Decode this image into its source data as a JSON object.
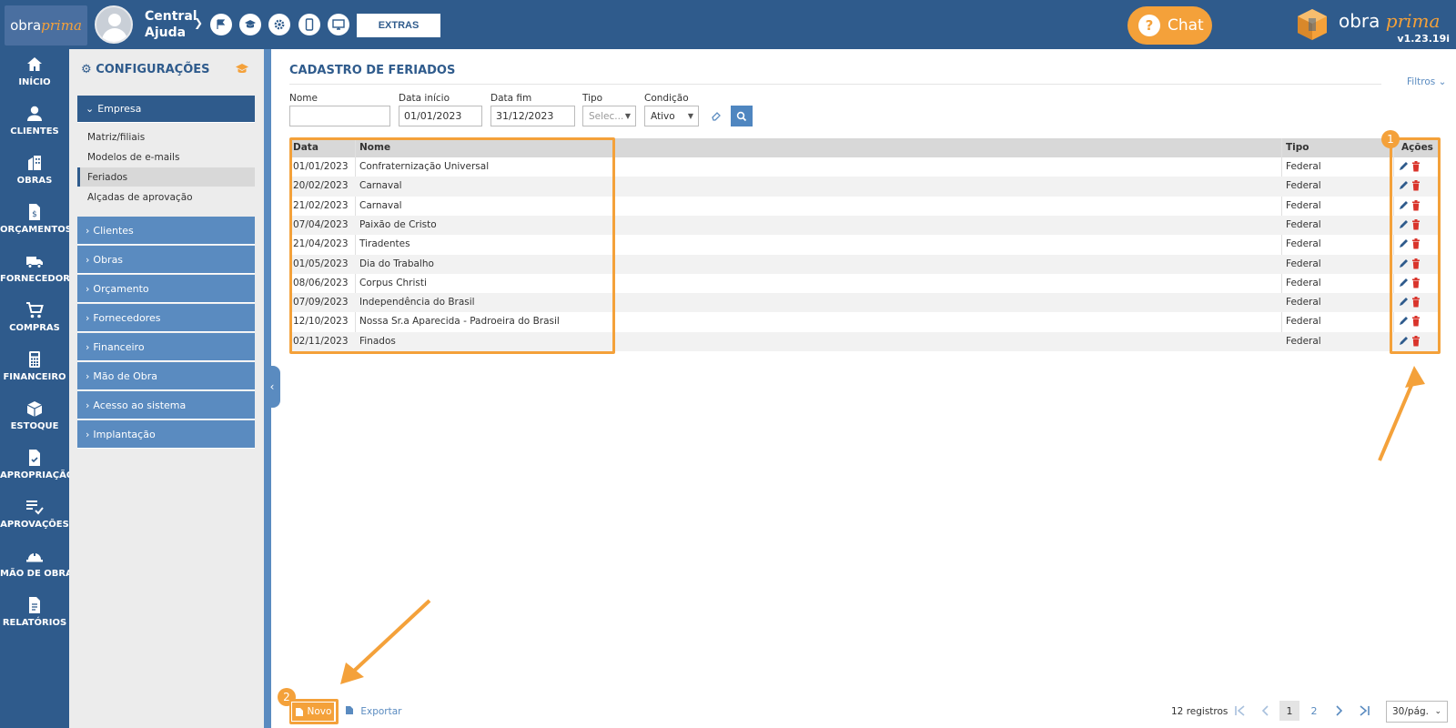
{
  "topbar": {
    "logo_left_a": "obra",
    "logo_left_b": "prima",
    "central_line1": "Central",
    "central_line2": "Ajuda",
    "extras_label": "EXTRAS",
    "chat_label": "Chat",
    "brand_a": "obra",
    "brand_b": "prima",
    "version": "v1.23.19i",
    "icons": [
      "flag-icon",
      "graduation-cap-icon",
      "gear-icon",
      "mobile-icon",
      "monitor-icon"
    ]
  },
  "nav": [
    {
      "label": "INÍCIO",
      "icon": "home-icon"
    },
    {
      "label": "CLIENTES",
      "icon": "person-icon"
    },
    {
      "label": "OBRAS",
      "icon": "building-icon"
    },
    {
      "label": "ORÇAMENTOS",
      "icon": "document-dollar-icon"
    },
    {
      "label": "FORNECEDORES",
      "icon": "truck-icon"
    },
    {
      "label": "COMPRAS",
      "icon": "cart-icon"
    },
    {
      "label": "FINANCEIRO",
      "icon": "calculator-icon"
    },
    {
      "label": "ESTOQUE",
      "icon": "box-icon"
    },
    {
      "label": "APROPRIAÇÃO",
      "icon": "document-check-icon"
    },
    {
      "label": "APROVAÇÕES",
      "icon": "list-check-icon"
    },
    {
      "label": "MÃO DE OBRA",
      "icon": "helmet-icon"
    },
    {
      "label": "RELATÓRIOS",
      "icon": "report-icon"
    }
  ],
  "config": {
    "title": "CONFIGURAÇÕES",
    "empresa": "Empresa",
    "empresa_items": [
      "Matriz/filiais",
      "Modelos de e-mails",
      "Feriados",
      "Alçadas de aprovação"
    ],
    "sections": [
      "Clientes",
      "Obras",
      "Orçamento",
      "Fornecedores",
      "Financeiro",
      "Mão de Obra",
      "Acesso ao sistema",
      "Implantação"
    ]
  },
  "page": {
    "title": "CADASTRO DE FERIADOS",
    "filtros": "Filtros"
  },
  "filters": {
    "nome_label": "Nome",
    "nome_value": "",
    "data_inicio_label": "Data início",
    "data_inicio_value": "01/01/2023",
    "data_fim_label": "Data fim",
    "data_fim_value": "31/12/2023",
    "tipo_label": "Tipo",
    "tipo_placeholder": "Selec...",
    "condicao_label": "Condição",
    "condicao_value": "Ativo"
  },
  "table": {
    "headers": {
      "data": "Data",
      "nome": "Nome",
      "tipo": "Tipo",
      "acoes": "Ações"
    },
    "rows": [
      {
        "data": "01/01/2023",
        "nome": "Confraternização Universal",
        "tipo": "Federal"
      },
      {
        "data": "20/02/2023",
        "nome": "Carnaval",
        "tipo": "Federal"
      },
      {
        "data": "21/02/2023",
        "nome": "Carnaval",
        "tipo": "Federal"
      },
      {
        "data": "07/04/2023",
        "nome": "Paixão de Cristo",
        "tipo": "Federal"
      },
      {
        "data": "21/04/2023",
        "nome": "Tiradentes",
        "tipo": "Federal"
      },
      {
        "data": "01/05/2023",
        "nome": "Dia do Trabalho",
        "tipo": "Federal"
      },
      {
        "data": "08/06/2023",
        "nome": "Corpus Christi",
        "tipo": "Federal"
      },
      {
        "data": "07/09/2023",
        "nome": "Independência do Brasil",
        "tipo": "Federal"
      },
      {
        "data": "12/10/2023",
        "nome": "Nossa Sr.a Aparecida - Padroeira do Brasil",
        "tipo": "Federal"
      },
      {
        "data": "02/11/2023",
        "nome": "Finados",
        "tipo": "Federal"
      }
    ]
  },
  "annotations": {
    "badge1": "1",
    "badge2": "2"
  },
  "footer": {
    "novo_label": "Novo",
    "exportar_label": "Exportar",
    "records": "12 registros",
    "page1": "1",
    "page2": "2",
    "per_page": "30/pág."
  },
  "colors": {
    "primary": "#2f5b8c",
    "secondary": "#5a8bc0",
    "accent": "#f4a13a",
    "danger": "#d9342b"
  }
}
